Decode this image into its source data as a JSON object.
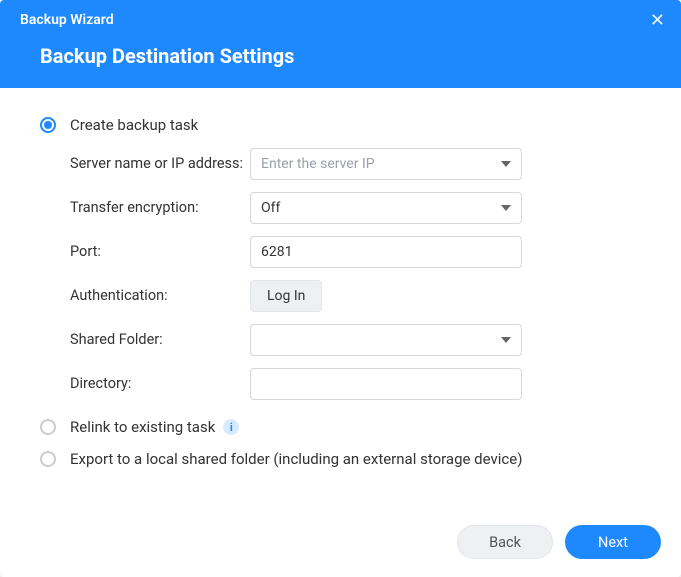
{
  "header": {
    "window_title": "Backup Wizard",
    "page_title": "Backup Destination Settings"
  },
  "options": {
    "create": {
      "label": "Create backup task",
      "selected": true
    },
    "relink": {
      "label": "Relink to existing task",
      "selected": false
    },
    "export": {
      "label": "Export to a local shared folder (including an external storage device)",
      "selected": false
    }
  },
  "form": {
    "server": {
      "label": "Server name or IP address:",
      "placeholder": "Enter the server IP",
      "value": ""
    },
    "encryption": {
      "label": "Transfer encryption:",
      "value": "Off"
    },
    "port": {
      "label": "Port:",
      "value": "6281"
    },
    "auth": {
      "label": "Authentication:",
      "button": "Log In"
    },
    "shared_folder": {
      "label": "Shared Folder:",
      "value": ""
    },
    "directory": {
      "label": "Directory:",
      "value": ""
    }
  },
  "footer": {
    "back": "Back",
    "next": "Next"
  },
  "icons": {
    "info": "i",
    "close": "✕"
  }
}
